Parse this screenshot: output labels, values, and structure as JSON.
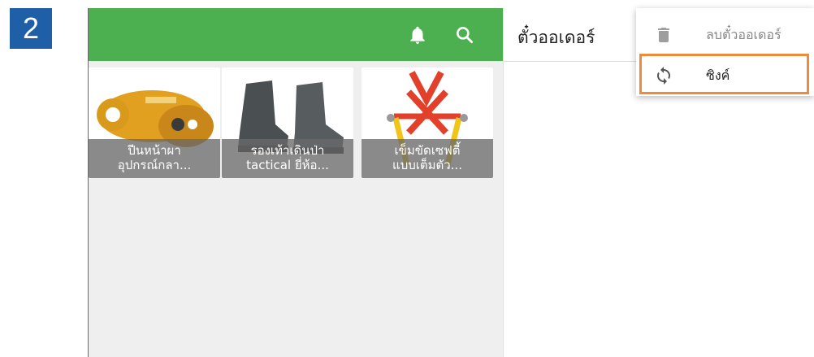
{
  "step": {
    "number": "2",
    "color": "#1f5fa8"
  },
  "appbar": {
    "color": "#4caf50",
    "icons": [
      "bell-icon",
      "search-icon"
    ]
  },
  "products": [
    {
      "caption_line1": "ปีนหน้าผา",
      "caption_line2": "อุปกรณ์กลา...",
      "image": "rope-clamp-device"
    },
    {
      "caption_line1": "รองเท้าเดินป่า",
      "caption_line2": "tactical ยี่ห้อ...",
      "image": "hiking-boots"
    },
    {
      "caption_line1": "เข็มขัดเซฟตี้",
      "caption_line2": "แบบเต็มตัว...",
      "image": "safety-harness"
    }
  ],
  "order": {
    "title": "ตั๋วออเดอร์"
  },
  "menu": {
    "items": [
      {
        "label": "ลบตั๋วออเดอร์",
        "icon": "trash-icon"
      },
      {
        "label": "ซิงค์",
        "icon": "sync-icon"
      }
    ],
    "highlight_color": "#ef8a3a"
  }
}
